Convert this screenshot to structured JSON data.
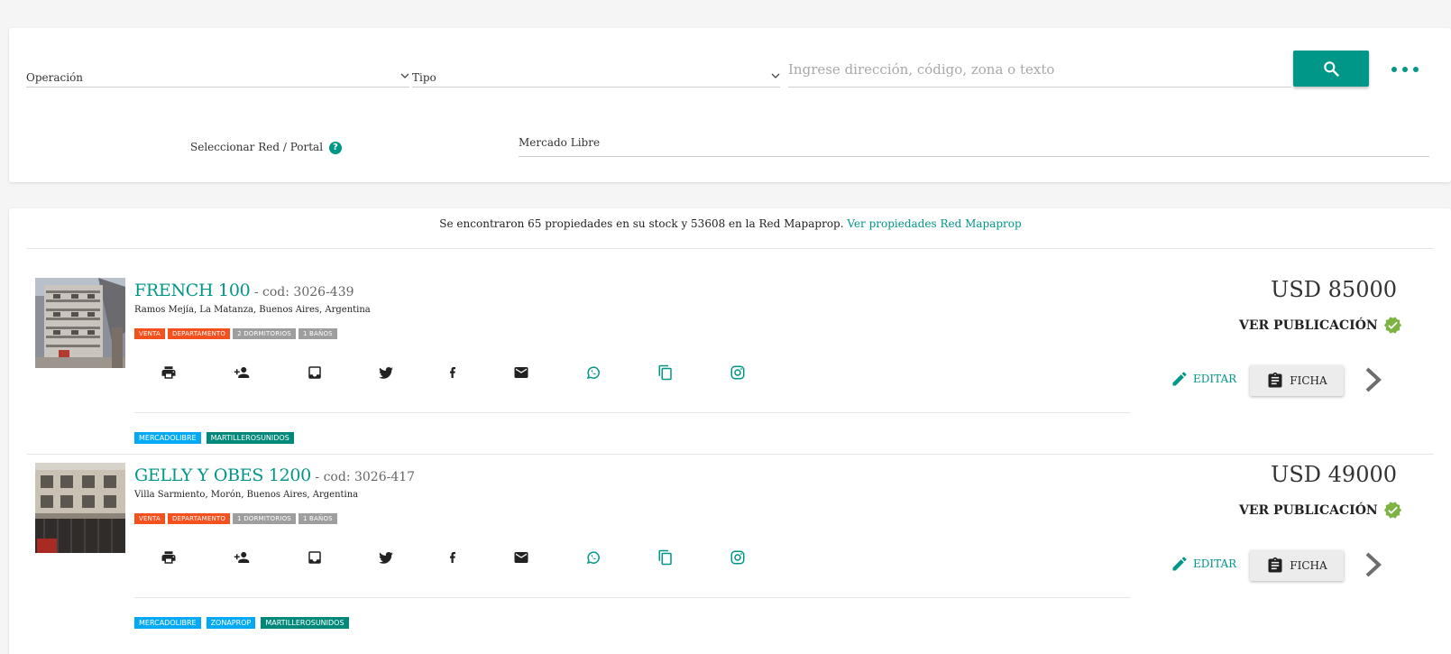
{
  "search": {
    "operacion_label": "Operación",
    "tipo_label": "Tipo",
    "query_placeholder": "Ingrese dirección, código, zona o texto",
    "query_value": "",
    "red_portal_label": "Seleccionar Red / Portal",
    "red_portal_help": "?",
    "portal_value": "Mercado Libre"
  },
  "results": {
    "summary_text": "Se encontraron 65 propiedades en su stock y 53608 en la Red Mapaprop.",
    "summary_link": "Ver propiedades Red Mapaprop"
  },
  "listings": [
    {
      "title": "FRENCH 100",
      "code": " - cod: 3026-439",
      "address": "Ramos Mejía, La Matanza, Buenos Aires, Argentina",
      "tags": [
        "VENTA",
        "DEPARTAMENTO",
        "2 DORMITORIOS",
        "1 BAÑOS"
      ],
      "portals": [
        "MERCADOLIBRE",
        "MARTILLEROSUNIDOS"
      ],
      "price": "USD 85000",
      "ver_publicacion": "VER PUBLICACIÓN",
      "edit_label": "EDITAR",
      "ficha_label": "FICHA"
    },
    {
      "title": "GELLY Y OBES 1200",
      "code": " - cod: 3026-417",
      "address": "Villa Sarmiento, Morón, Buenos Aires, Argentina",
      "tags": [
        "VENTA",
        "DEPARTAMENTO",
        "1 DORMITORIOS",
        "1 BAÑOS"
      ],
      "portals": [
        "MERCADOLIBRE",
        "ZONAPROP",
        "MARTILLEROSUNIDOS"
      ],
      "price": "USD 49000",
      "ver_publicacion": "VER PUBLICACIÓN",
      "edit_label": "EDITAR",
      "ficha_label": "FICHA"
    }
  ],
  "colors": {
    "accent": "#009688",
    "tag_orange": "#f4511e",
    "tag_gray": "#9e9e9e",
    "portal_blue": "#03a9f4",
    "portal_teal": "#00897b",
    "verified_green": "#7cb342"
  },
  "icons": [
    "print-icon",
    "person-add-icon",
    "inbox-icon",
    "twitter-icon",
    "facebook-icon",
    "mail-icon",
    "whatsapp-icon",
    "copy-icon",
    "instagram-icon",
    "pencil-icon",
    "clipboard-icon",
    "chevron-right-icon",
    "verified-icon",
    "search-icon",
    "more-icon"
  ]
}
